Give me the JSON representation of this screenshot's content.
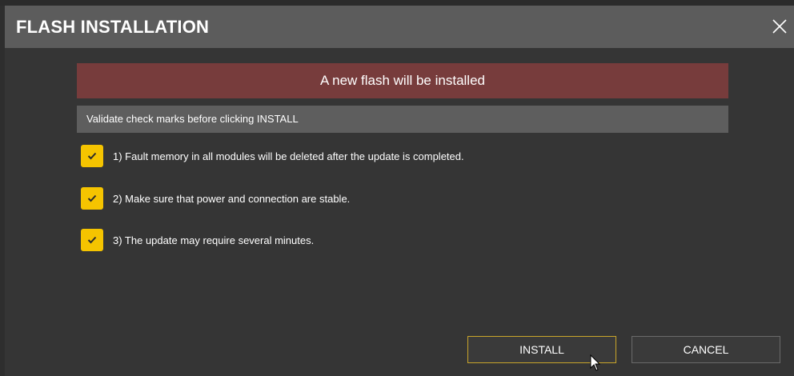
{
  "window": {
    "title": "FLASH INSTALLATION",
    "close_icon": "close-icon"
  },
  "banner": {
    "text": "A new flash will be installed",
    "color": "#773c3c"
  },
  "subheader": {
    "text": "Validate check marks before clicking INSTALL"
  },
  "checklist": [
    {
      "label": "1) Fault memory in all modules will be deleted after the update is completed.",
      "checked": true
    },
    {
      "label": "2) Make sure that power and connection are stable.",
      "checked": true
    },
    {
      "label": "3) The update may require several minutes.",
      "checked": true
    }
  ],
  "buttons": {
    "install_label": "INSTALL",
    "cancel_label": "CANCEL"
  },
  "colors": {
    "accent_checkbox": "#f5c400",
    "install_border": "#c9a52a",
    "titlebar": "#5c5c5c"
  }
}
